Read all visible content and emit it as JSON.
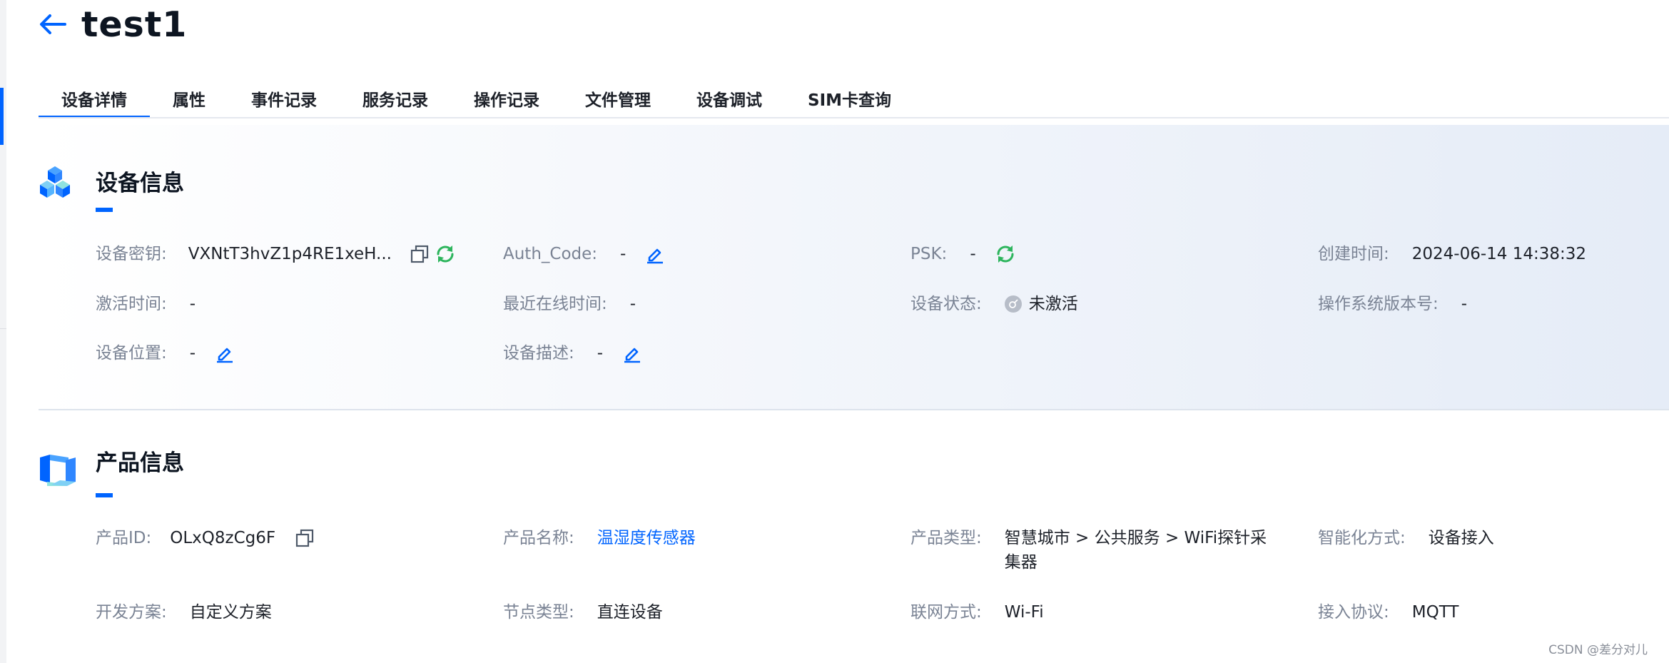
{
  "header": {
    "title": "test1"
  },
  "tabs": [
    {
      "label": "设备详情",
      "active": true
    },
    {
      "label": "属性"
    },
    {
      "label": "事件记录"
    },
    {
      "label": "服务记录"
    },
    {
      "label": "操作记录"
    },
    {
      "label": "文件管理"
    },
    {
      "label": "设备调试"
    },
    {
      "label": "SIM卡查询"
    }
  ],
  "device_info": {
    "title": "设备信息",
    "device_key": {
      "label": "设备密钥:",
      "value": "VXNtT3hvZ1p4RE1xeH..."
    },
    "auth_code": {
      "label": "Auth_Code:",
      "value": "-"
    },
    "psk": {
      "label": "PSK:",
      "value": "-"
    },
    "created_time": {
      "label": "创建时间:",
      "value": "2024-06-14 14:38:32"
    },
    "activated_time": {
      "label": "激活时间:",
      "value": "-"
    },
    "last_online": {
      "label": "最近在线时间:",
      "value": "-"
    },
    "device_status": {
      "label": "设备状态:",
      "value": "未激活"
    },
    "os_version": {
      "label": "操作系统版本号:",
      "value": "-"
    },
    "location": {
      "label": "设备位置:",
      "value": "-"
    },
    "description": {
      "label": "设备描述:",
      "value": "-"
    }
  },
  "product_info": {
    "title": "产品信息",
    "product_id": {
      "label": "产品ID:",
      "value": "OLxQ8zCg6F"
    },
    "product_name": {
      "label": "产品名称:",
      "value": "温湿度传感器"
    },
    "product_type": {
      "label": "产品类型:",
      "value": "智慧城市 > 公共服务 > WiFi探针采集器"
    },
    "smart_mode": {
      "label": "智能化方式:",
      "value": "设备接入"
    },
    "dev_plan": {
      "label": "开发方案:",
      "value": "自定义方案"
    },
    "node_type": {
      "label": "节点类型:",
      "value": "直连设备"
    },
    "network": {
      "label": "联网方式:",
      "value": "Wi-Fi"
    },
    "protocol": {
      "label": "接入协议:",
      "value": "MQTT"
    }
  },
  "watermark": "CSDN @差分对儿",
  "colors": {
    "accent": "#0064ff",
    "refresh": "#2db55d",
    "label": "#7a8394"
  }
}
